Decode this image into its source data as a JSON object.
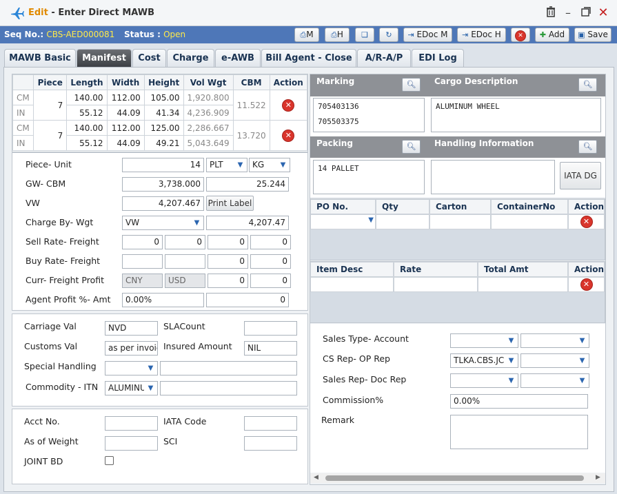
{
  "window": {
    "title_prefix": "Edit",
    "title_sep": " - ",
    "title": "Enter Direct MAWB"
  },
  "record": {
    "seq_label": "Seq No.:",
    "seq_value": "CBS-AED000081",
    "status_label": "Status :",
    "status_value": "Open"
  },
  "toolbar": {
    "print_m": "M",
    "print_h": "H",
    "edoc_m": "EDoc M",
    "edoc_h": "EDoc H",
    "add": "Add",
    "save": "Save"
  },
  "tabs": [
    "MAWB Basic",
    "Manifest",
    "Cost",
    "Charge",
    "e-AWB",
    "Bill Agent - Close",
    "A/R-A/P",
    "EDI Log"
  ],
  "dimensions": {
    "headers": [
      "Piece",
      "Length",
      "Width",
      "Height",
      "Vol Wgt",
      "CBM",
      "Action"
    ],
    "rows": [
      {
        "cm": "CM",
        "in": "IN",
        "piece": "7",
        "length_cm": "140.00",
        "width_cm": "112.00",
        "height_cm": "105.00",
        "vol_cm": "1,920.800",
        "length_in": "55.12",
        "width_in": "44.09",
        "height_in": "41.34",
        "vol_in": "4,236.909",
        "cbm": "11.522"
      },
      {
        "cm": "CM",
        "in": "IN",
        "piece": "7",
        "length_cm": "140.00",
        "width_cm": "112.00",
        "height_cm": "125.00",
        "vol_cm": "2,286.667",
        "length_in": "55.12",
        "width_in": "44.09",
        "height_in": "49.21",
        "vol_in": "5,043.649",
        "cbm": "13.720"
      }
    ]
  },
  "form1": {
    "piece_unit_label": "Piece- Unit",
    "piece_value": "14",
    "unit_value": "PLT",
    "wunit_value": "KG",
    "gw_cbm_label": "GW- CBM",
    "gw_value": "3,738.000",
    "cbm_value": "25.244",
    "vw_label": "VW",
    "vw_value": "4,207.467",
    "print_label_btn": "Print Label",
    "charge_by_label": "Charge By- Wgt",
    "charge_by_value": "VW",
    "charge_wgt_value": "4,207.47",
    "sell_rate_label": "Sell Rate- Freight",
    "sell_rate_values": [
      "0",
      "0",
      "0",
      "0"
    ],
    "buy_rate_label": "Buy Rate- Freight",
    "buy_rate_values": [
      "",
      "",
      "0",
      "0"
    ],
    "curr_label": "Curr- Freight Profit",
    "curr1": "CNY",
    "curr2": "USD",
    "curr_values": [
      "0",
      "0"
    ],
    "agent_profit_label": "Agent Profit %- Amt",
    "agent_profit_pct": "0.00%",
    "agent_profit_amt": "0"
  },
  "form2": {
    "carriage_val_label": "Carriage Val",
    "carriage_val": "NVD",
    "sla_count_label": "SLACount",
    "sla_count": "",
    "customs_val_label": "Customs Val",
    "customs_val": "as per invoic",
    "insured_label": "Insured Amount",
    "insured_val": "NIL",
    "special_handling_label": "Special Handling",
    "special_handling": "",
    "special_handling_text": "",
    "commodity_label": "Commodity -  ITN",
    "commodity_value": "ALUMINU",
    "itn_value": ""
  },
  "form3": {
    "acct_label": "Acct No.",
    "acct_val": "",
    "iata_code_label": "IATA Code",
    "iata_code_val": "",
    "as_of_weight_label": "As of Weight",
    "as_of_weight_val": "",
    "sci_label": "SCI",
    "sci_val": "",
    "joint_bd_label": "JOINT BD"
  },
  "right": {
    "marking_label": "Marking",
    "marking_text": "705403136\n705503375",
    "cargo_desc_label": "Cargo Description",
    "cargo_desc_text": "ALUMINUM WHEEL",
    "packing_label": "Packing",
    "packing_text": "14 PALLET",
    "handling_label": "Handling Information",
    "handling_text": "",
    "iata_dg_btn": "IATA DG",
    "po_headers": [
      "PO No.",
      "Qty",
      "Carton",
      "ContainerNo",
      "Action"
    ],
    "item_headers": [
      "Item Desc",
      "Rate",
      "Total Amt",
      "Action"
    ],
    "sales_type_label": "Sales Type- Account",
    "cs_rep_label": "CS Rep- OP Rep",
    "cs_rep_value": "TLKA.CBS.JC",
    "sales_rep_label": "Sales Rep- Doc Rep",
    "commission_label": "Commission%",
    "commission_value": "0.00%",
    "remark_label": "Remark",
    "remark_value": ""
  },
  "colors": {
    "accent": "#4e77b8",
    "status": "#ffea4a",
    "delete": "#d9352c",
    "header_bar": "#8e9196"
  },
  "icons": [
    "plane-icon",
    "trash-icon",
    "minimize-icon",
    "restore-icon",
    "close-icon",
    "printer-icon",
    "copy-icon",
    "refresh-icon",
    "edoc-icon",
    "cancel-icon",
    "add-icon",
    "save-icon",
    "magnifier-icon",
    "delete-icon",
    "chevron-down-icon"
  ]
}
